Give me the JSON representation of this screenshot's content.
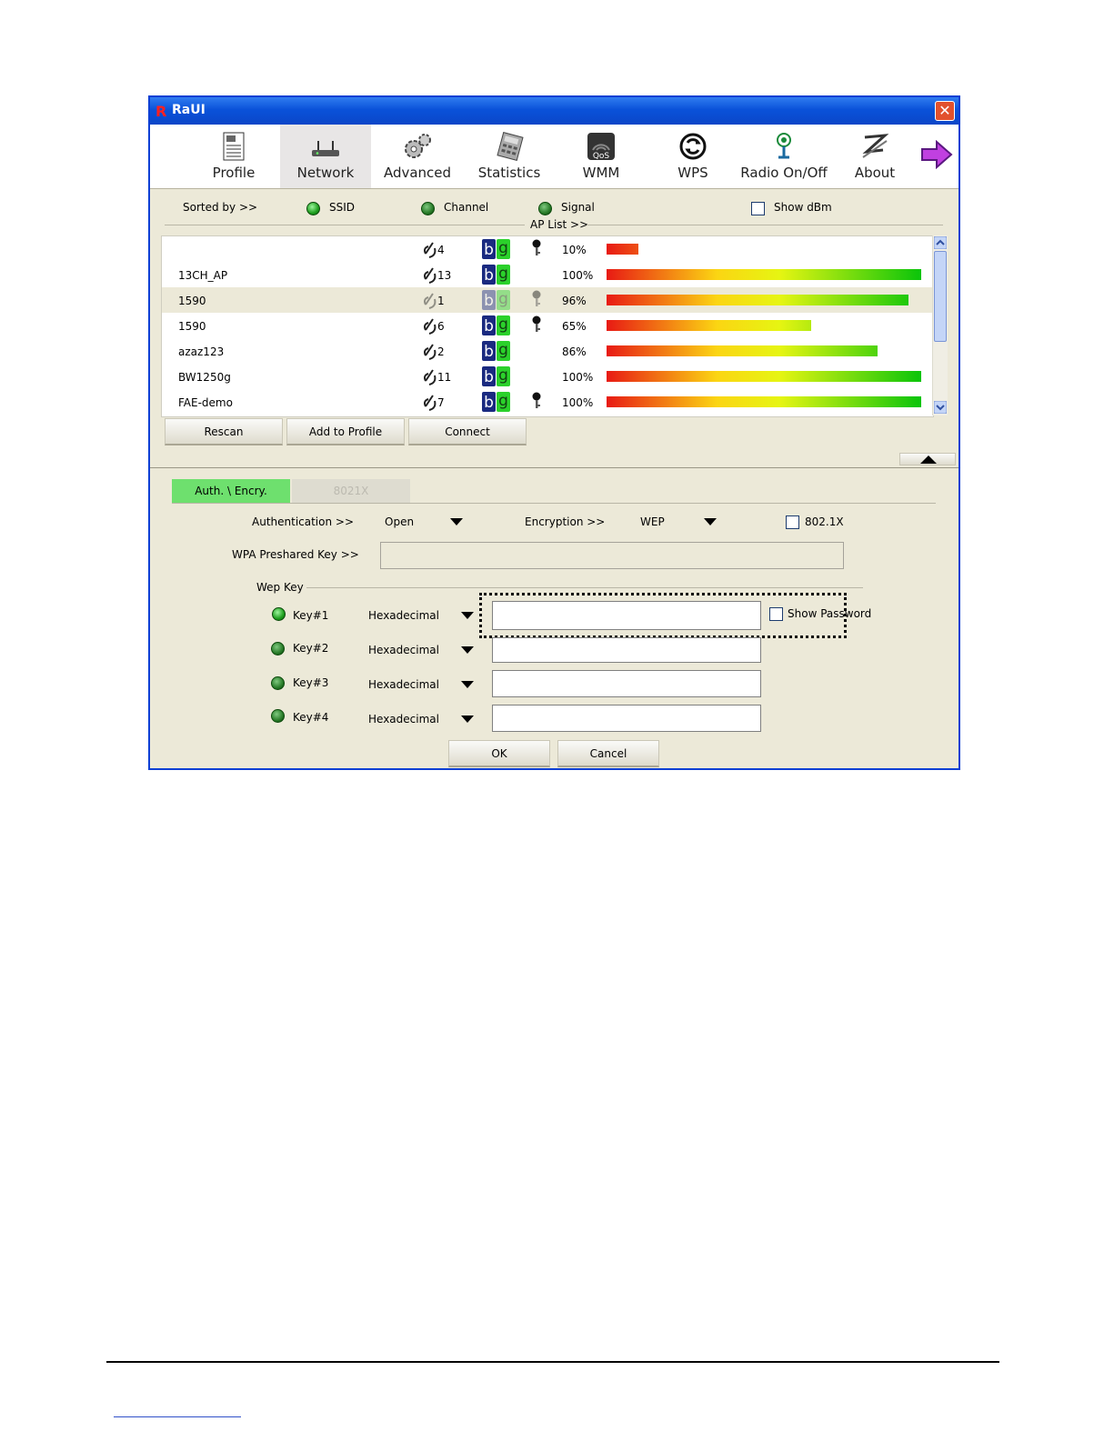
{
  "window": {
    "title": "RaUI",
    "close": "✕"
  },
  "toolbar": [
    {
      "label": "Profile",
      "icon": "profile-icon"
    },
    {
      "label": "Network",
      "icon": "network-icon",
      "active": true
    },
    {
      "label": "Advanced",
      "icon": "advanced-icon"
    },
    {
      "label": "Statistics",
      "icon": "statistics-icon"
    },
    {
      "label": "WMM",
      "icon": "wmm-icon"
    },
    {
      "label": "WPS",
      "icon": "wps-icon"
    },
    {
      "label": "Radio On/Off",
      "icon": "radio-icon"
    },
    {
      "label": "About",
      "icon": "about-icon"
    }
  ],
  "sort": {
    "label": "Sorted by >>",
    "ssid": "SSID",
    "channel": "Channel",
    "signal": "Signal",
    "show_dbm": "Show dBm",
    "ap_list": "AP List >>"
  },
  "aps": [
    {
      "ssid": "",
      "channel": "4",
      "locked": true,
      "signal": 10,
      "signal_label": "10%"
    },
    {
      "ssid": "13CH_AP",
      "channel": "13",
      "locked": false,
      "signal": 100,
      "signal_label": "100%"
    },
    {
      "ssid": "1590",
      "channel": "1",
      "locked": true,
      "signal": 96,
      "signal_label": "96%",
      "selected": true
    },
    {
      "ssid": "1590",
      "channel": "6",
      "locked": true,
      "signal": 65,
      "signal_label": "65%"
    },
    {
      "ssid": "azaz123",
      "channel": "2",
      "locked": false,
      "signal": 86,
      "signal_label": "86%"
    },
    {
      "ssid": "BW1250g",
      "channel": "11",
      "locked": false,
      "signal": 100,
      "signal_label": "100%"
    },
    {
      "ssid": "FAE-demo",
      "channel": "7",
      "locked": true,
      "signal": 100,
      "signal_label": "100%"
    }
  ],
  "buttons": {
    "rescan": "Rescan",
    "add_profile": "Add to Profile",
    "connect": "Connect"
  },
  "tabs": {
    "auth": "Auth. \\ Encry.",
    "dot1x": "8021X"
  },
  "security": {
    "auth_label": "Authentication >>",
    "auth_value": "Open",
    "enc_label": "Encryption >>",
    "enc_value": "WEP",
    "dot1x_label": "802.1X",
    "wpa_label": "WPA Preshared Key >>",
    "wep_label": "Wep Key",
    "show_password": "Show Password"
  },
  "keys": [
    {
      "label": "Key#1",
      "format": "Hexadecimal"
    },
    {
      "label": "Key#2",
      "format": "Hexadecimal"
    },
    {
      "label": "Key#3",
      "format": "Hexadecimal"
    },
    {
      "label": "Key#4",
      "format": "Hexadecimal"
    }
  ],
  "dialog": {
    "ok": "OK",
    "cancel": "Cancel"
  }
}
